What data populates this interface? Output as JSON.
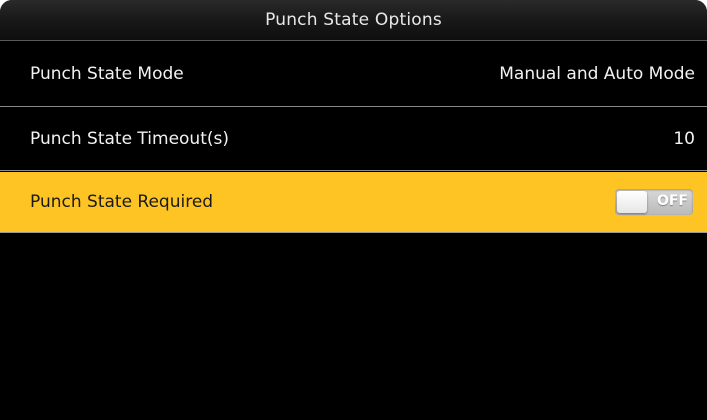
{
  "header": {
    "title": "Punch State Options"
  },
  "settings": [
    {
      "label": "Punch State Mode",
      "value": "Manual and Auto Mode"
    },
    {
      "label": "Punch State Timeout(s)",
      "value": "10"
    },
    {
      "label": "Punch State Required",
      "toggle": {
        "state": "off",
        "text": "OFF"
      },
      "selected": true
    }
  ],
  "colors": {
    "background": "#000000",
    "highlight": "#fdc424",
    "text": "#f2f2f2",
    "divider": "#8a8a8a"
  }
}
